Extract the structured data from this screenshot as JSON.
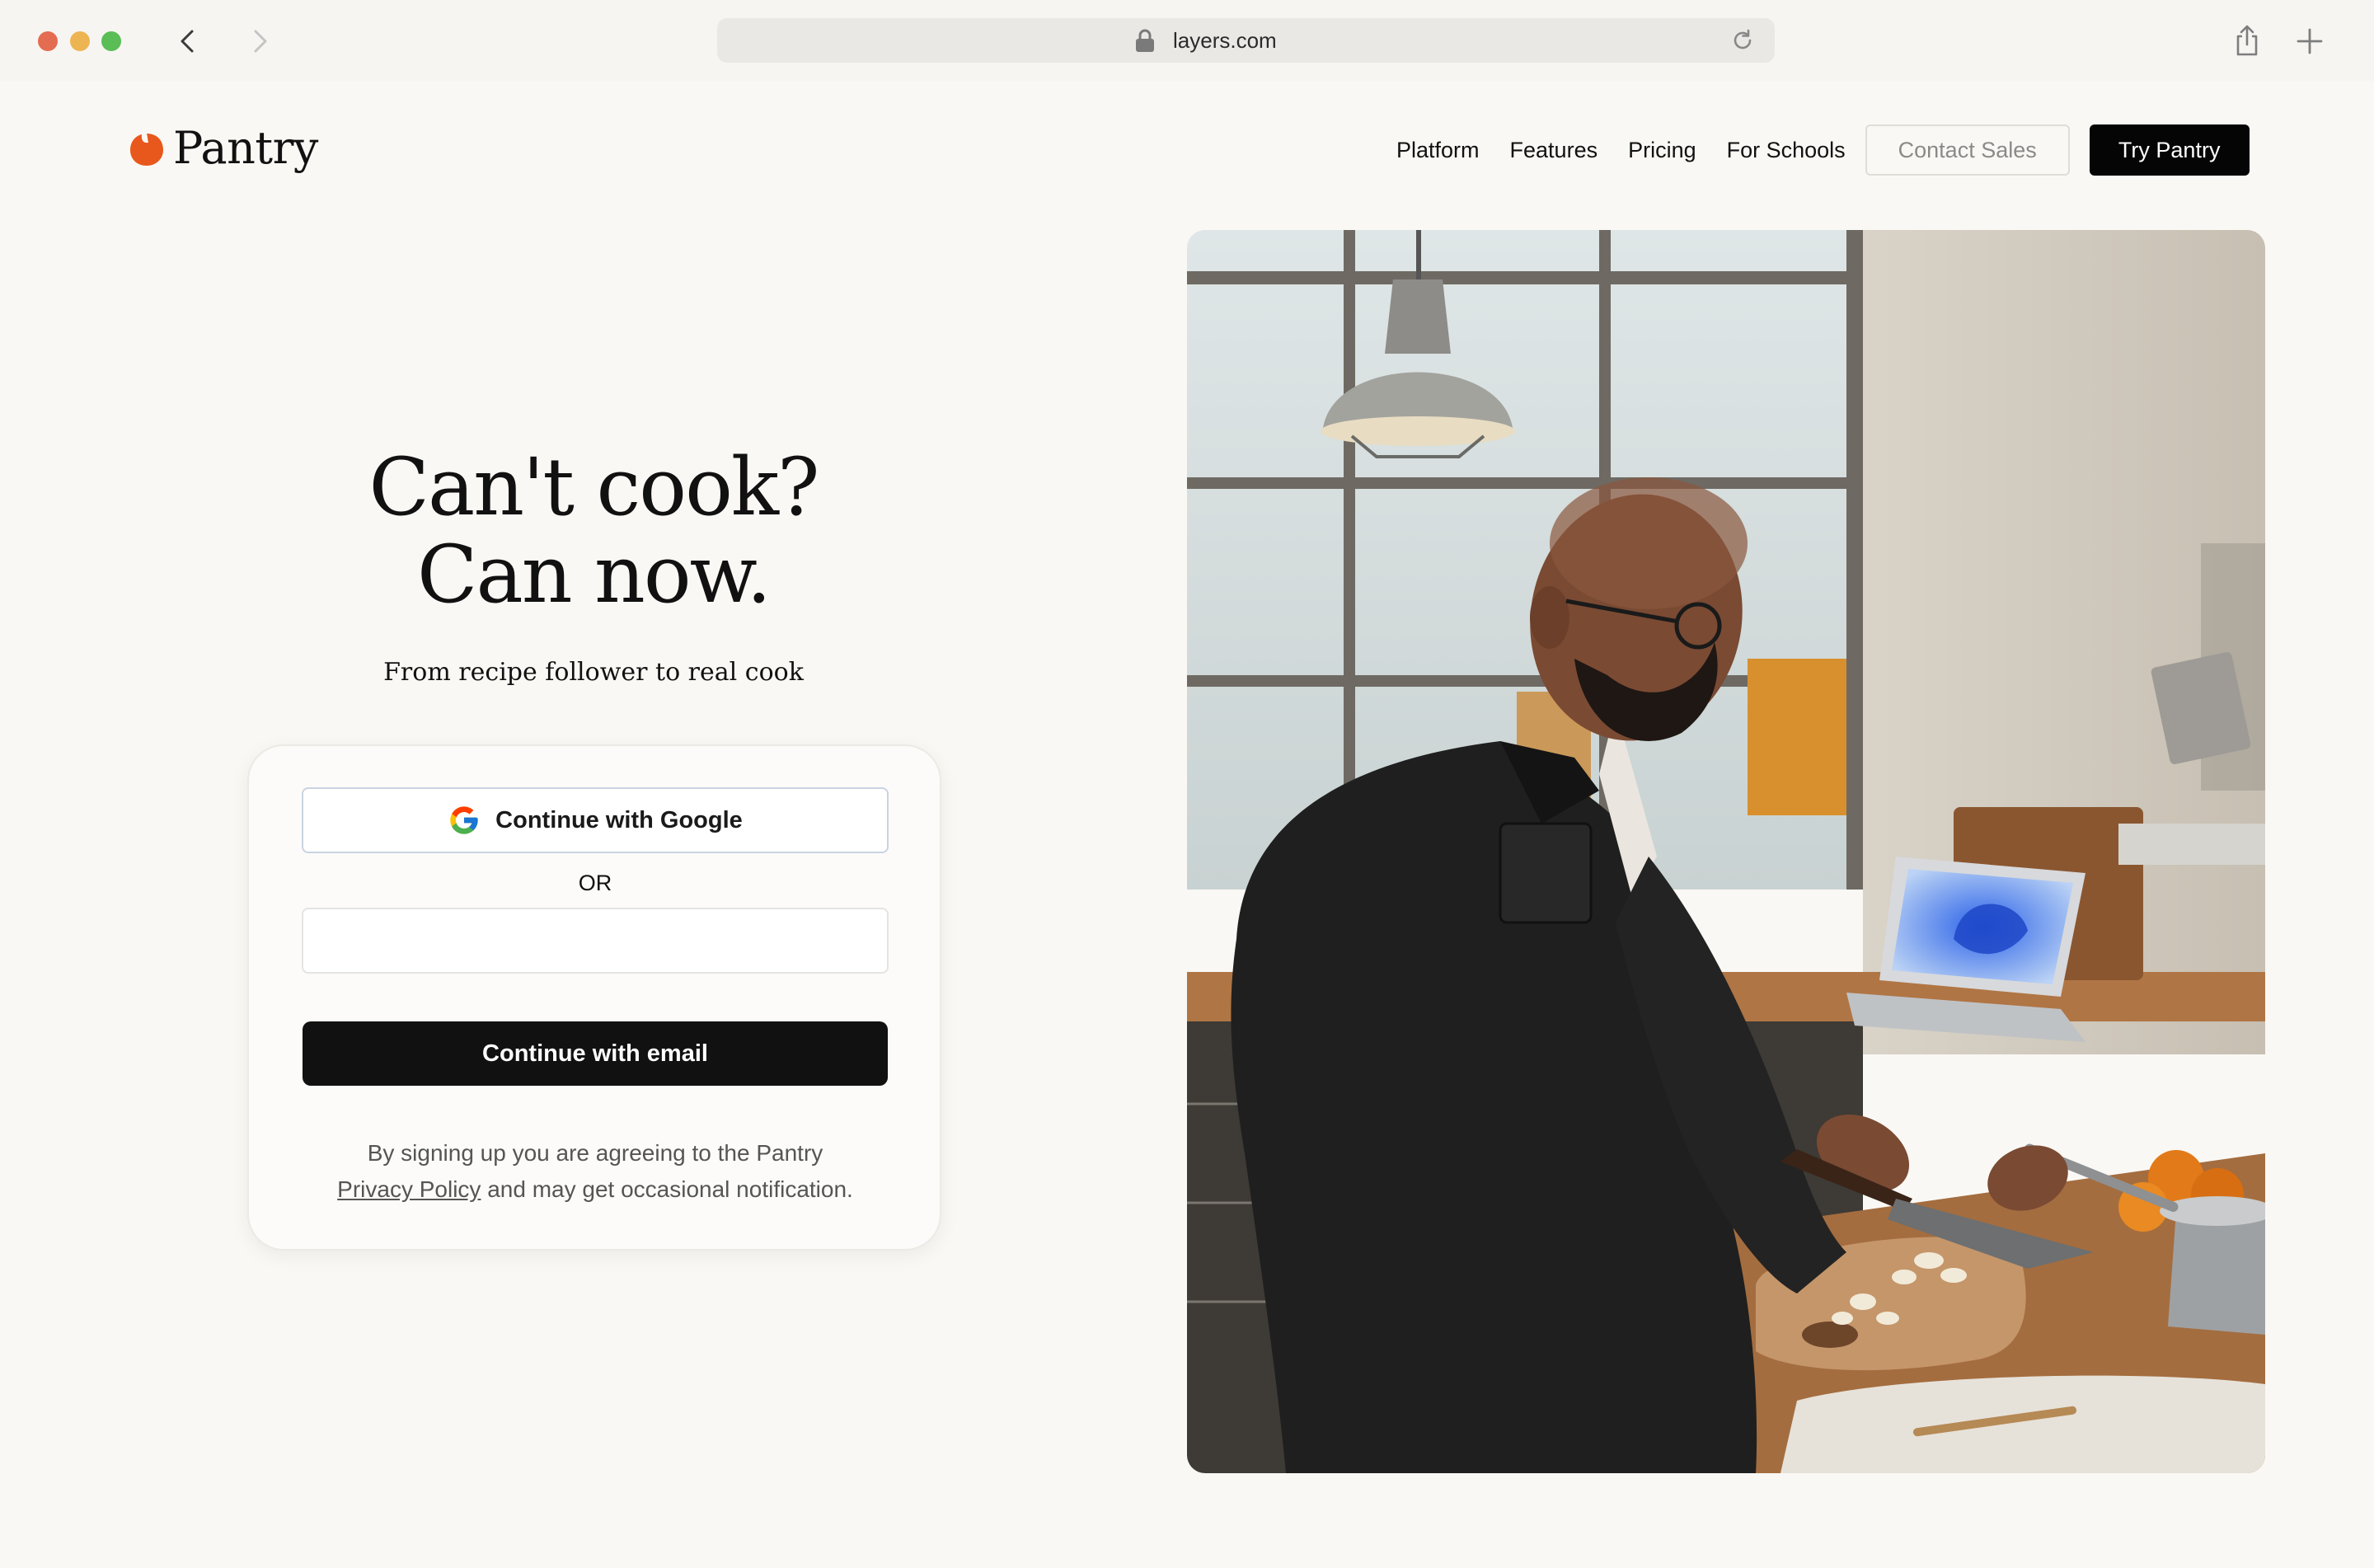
{
  "browser": {
    "url": "layers.com",
    "icons": [
      "back-icon",
      "forward-icon",
      "lock-icon",
      "reload-icon",
      "share-icon",
      "plus-icon"
    ]
  },
  "brand": {
    "name": "Pantry",
    "accent": "#e8581c"
  },
  "nav": {
    "items": [
      {
        "label": "Platform"
      },
      {
        "label": "Features"
      },
      {
        "label": "Pricing"
      },
      {
        "label": "For Schools"
      }
    ],
    "contact_label": "Contact Sales",
    "try_label": "Try Pantry"
  },
  "hero": {
    "title_line1": "Can't cook?",
    "title_line2": "Can now.",
    "subtitle": "From recipe follower to real cook"
  },
  "signup": {
    "google_label": "Continue with Google",
    "or_label": "OR",
    "email_value": "",
    "email_placeholder": "",
    "email_button_label": "Continue with email",
    "legal_prefix": "By signing up you are agreeing to the Pantry",
    "legal_link": "Privacy Policy",
    "legal_suffix": "and may get occasional notification."
  },
  "colors": {
    "background": "#faf8f4",
    "primary_button": "#111111",
    "card_border": "#eceae5"
  }
}
